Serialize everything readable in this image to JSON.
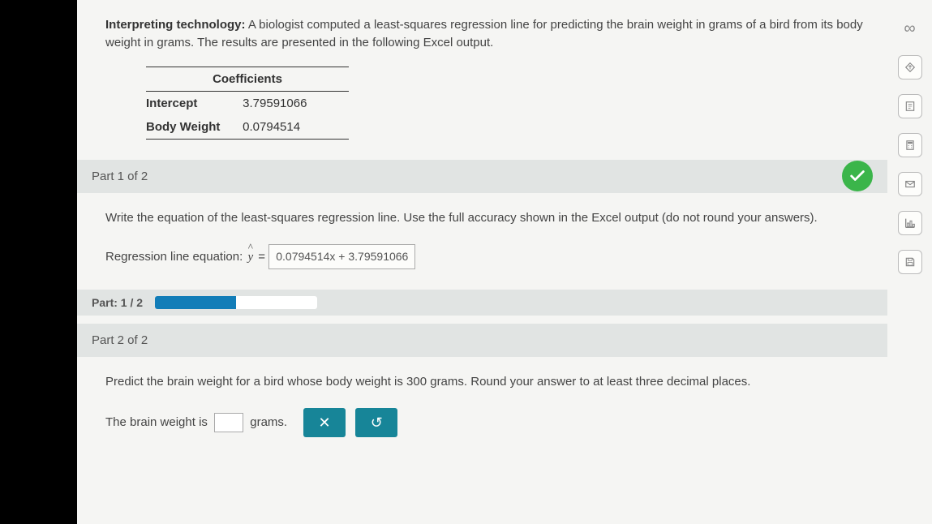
{
  "intro": {
    "bold": "Interpreting technology:",
    "text": " A biologist computed a least-squares regression line for predicting the brain weight in grams of a bird from its body weight in grams. The results are presented in the following Excel output."
  },
  "table": {
    "header": "Coefficients",
    "rows": [
      {
        "label": "Intercept",
        "value": "3.79591066"
      },
      {
        "label": "Body Weight",
        "value": "0.0794514"
      }
    ]
  },
  "part1": {
    "title": "Part 1 of 2",
    "prompt": "Write the equation of the least-squares regression line. Use the full accuracy shown in the Excel output (do not round your answers).",
    "eq_label": "Regression line equation: ",
    "eq_value": "0.0794514x + 3.79591066"
  },
  "progress": {
    "label": "Part: 1 / 2",
    "percent": 50
  },
  "part2": {
    "title": "Part 2 of 2",
    "prompt": "Predict the brain weight for a bird whose body weight is 300 grams. Round your answer to at least three decimal places.",
    "ans_prefix": "The brain weight is",
    "ans_suffix": "grams."
  },
  "buttons": {
    "clear": "✕",
    "reset": "↺"
  },
  "tools": {
    "inf": "∞"
  }
}
